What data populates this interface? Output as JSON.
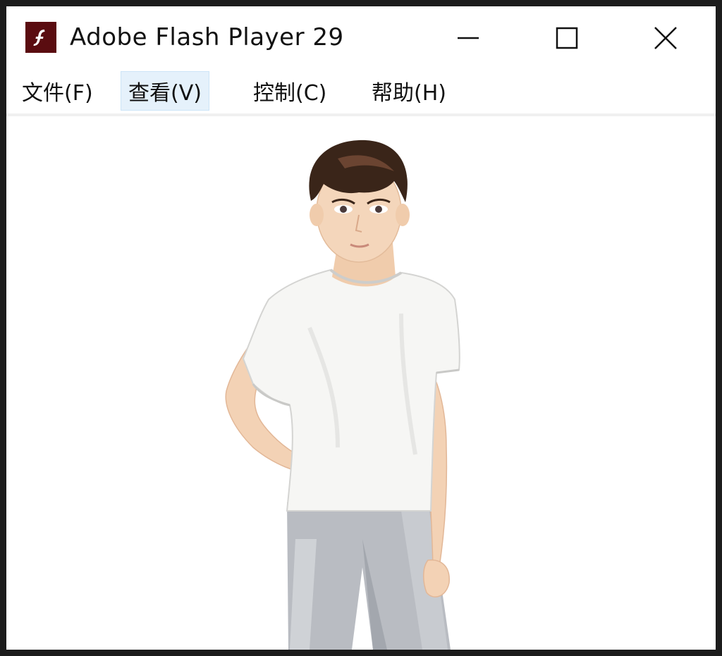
{
  "window": {
    "title": "Adobe Flash Player 29",
    "app_icon": "flash-player-icon",
    "controls": {
      "minimize_icon": "minimize-icon",
      "maximize_icon": "maximize-icon",
      "close_icon": "close-icon"
    }
  },
  "menubar": {
    "items": [
      {
        "label": "文件(F)"
      },
      {
        "label": "查看(V)",
        "active": true
      },
      {
        "label": "控制(C)"
      },
      {
        "label": "帮助(H)"
      }
    ]
  },
  "stage": {
    "content": "character-illustration"
  },
  "colors": {
    "icon_bg": "#5a0c10",
    "menu_active_bg": "#e5f1fb",
    "menu_active_border": "#cce4f7",
    "window_frame": "#1c1c1c"
  }
}
